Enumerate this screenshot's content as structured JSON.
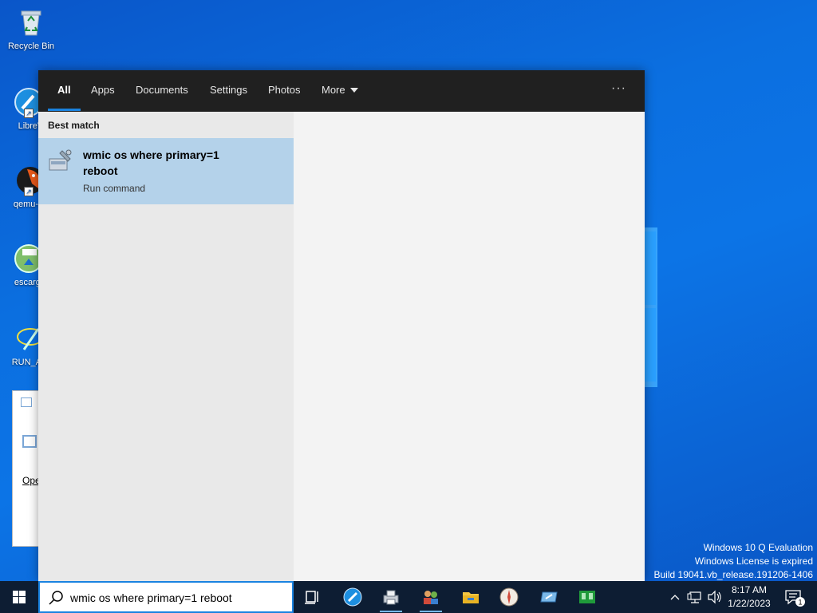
{
  "desktop": {
    "icons": [
      {
        "label": "Recycle Bin",
        "icon": "recycle-bin-icon"
      },
      {
        "label": "LibreW",
        "icon": "librewolf-icon"
      },
      {
        "label": "qemu-sy",
        "icon": "qemu-icon"
      },
      {
        "label": "escargot",
        "icon": "escargot-icon"
      },
      {
        "label": "RUN_AP",
        "icon": "run-app-icon"
      }
    ],
    "bg_window_text": "Ope",
    "watermark": [
      "Windows 10 Q Evaluation",
      "Windows License is expired",
      "Build 19041.vb_release.191206-1406"
    ]
  },
  "search_panel": {
    "tabs": [
      {
        "label": "All",
        "active": true
      },
      {
        "label": "Apps"
      },
      {
        "label": "Documents"
      },
      {
        "label": "Settings"
      },
      {
        "label": "Photos"
      },
      {
        "label": "More"
      }
    ],
    "more_options_label": "···",
    "section_header": "Best match",
    "best_match": {
      "title": "wmic os where primary=1 reboot",
      "subtitle": "Run command",
      "icon": "run-command-icon"
    }
  },
  "taskbar": {
    "search_value": "wmic os where primary=1 reboot",
    "apps": [
      "task-view-icon",
      "librewolf-icon",
      "printer-icon",
      "people-icon",
      "file-explorer-icon",
      "escargot-icon",
      "run-app-icon",
      "green-app-icon"
    ],
    "clock": {
      "time": "8:17 AM",
      "date": "1/22/2023"
    },
    "notification_count": "1"
  },
  "colors": {
    "accent": "#1a83e0",
    "selected_result": "#b4d2ea",
    "header_bg": "#202020",
    "taskbar_bg": "#0d1d33"
  }
}
